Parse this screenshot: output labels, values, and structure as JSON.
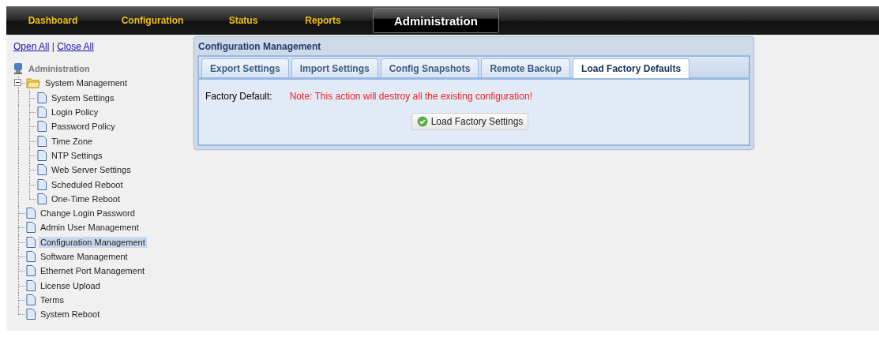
{
  "nav": {
    "items": [
      {
        "label": "Dashboard",
        "selected": false
      },
      {
        "label": "Configuration",
        "selected": false
      },
      {
        "label": "Status",
        "selected": false
      },
      {
        "label": "Reports",
        "selected": false
      },
      {
        "label": "Administration",
        "selected": true
      }
    ]
  },
  "sidebar": {
    "links": [
      "Open All",
      "Close All"
    ],
    "separator": "|",
    "tree": {
      "label": "Administration",
      "children": [
        {
          "label": "System Management",
          "kind": "folder",
          "expanded": true,
          "selected": false,
          "children": [
            {
              "label": "System Settings",
              "kind": "page",
              "selected": false
            },
            {
              "label": "Login Policy",
              "kind": "page",
              "selected": false
            },
            {
              "label": "Password Policy",
              "kind": "page",
              "selected": false
            },
            {
              "label": "Time Zone",
              "kind": "page",
              "selected": false
            },
            {
              "label": "NTP Settings",
              "kind": "page",
              "selected": false
            },
            {
              "label": "Web Server Settings",
              "kind": "page",
              "selected": false
            },
            {
              "label": "Scheduled Reboot",
              "kind": "page",
              "selected": false
            },
            {
              "label": "One-Time Reboot",
              "kind": "page",
              "selected": false
            }
          ]
        },
        {
          "label": "Change Login Password",
          "kind": "page",
          "selected": false
        },
        {
          "label": "Admin User Management",
          "kind": "page",
          "selected": false
        },
        {
          "label": "Configuration Management",
          "kind": "page",
          "selected": true
        },
        {
          "label": "Software Management",
          "kind": "page",
          "selected": false
        },
        {
          "label": "Ethernet Port Management",
          "kind": "page",
          "selected": false
        },
        {
          "label": "License Upload",
          "kind": "page",
          "selected": false
        },
        {
          "label": "Terms",
          "kind": "page",
          "selected": false
        },
        {
          "label": "System Reboot",
          "kind": "page",
          "selected": false
        }
      ]
    }
  },
  "panel": {
    "title": "Configuration Management",
    "tabs": [
      {
        "label": "Export Settings",
        "selected": false
      },
      {
        "label": "Import Settings",
        "selected": false
      },
      {
        "label": "Config Snapshots",
        "selected": false
      },
      {
        "label": "Remote Backup",
        "selected": false
      },
      {
        "label": "Load Factory Defaults",
        "selected": true
      }
    ],
    "field_label": "Factory Default:",
    "warning": "Note: This action will destroy all the existing configuration!",
    "button": "Load Factory Settings"
  }
}
